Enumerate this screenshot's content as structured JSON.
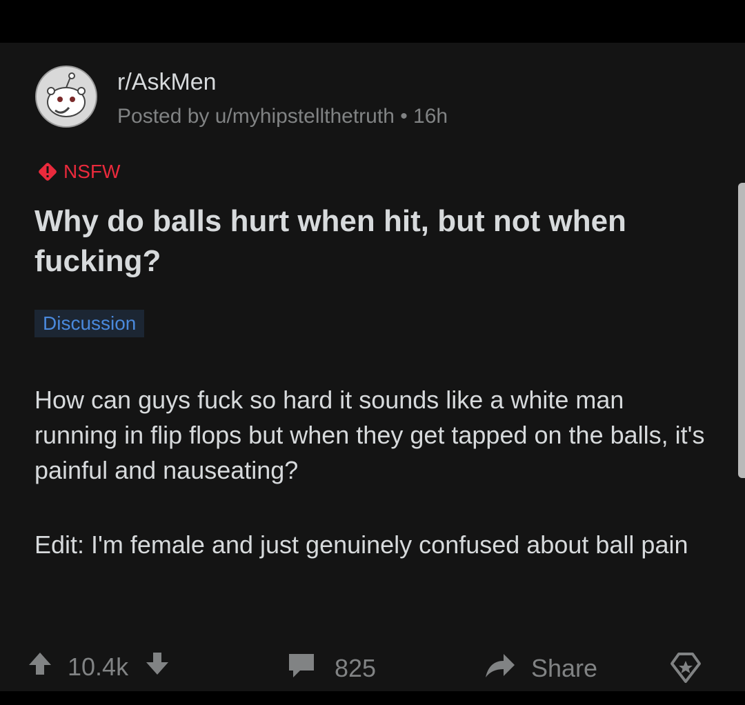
{
  "post": {
    "subreddit": "r/AskMen",
    "meta": "Posted by u/myhipstellthetruth • 16h",
    "nsfw_label": "NSFW",
    "title": "Why do balls hurt when hit, but not when fucking?",
    "flair": "Discussion",
    "body": [
      "How can guys fuck so hard it sounds like a white man running in flip flops but when they get tapped on the balls, it's painful and nauseating?",
      "Edit: I'm female and just genuinely confused about ball pain"
    ]
  },
  "actions": {
    "score": "10.4k",
    "comments": "825",
    "share_label": "Share"
  },
  "icons": {
    "avatar": "reddit-snoo-avatar-icon",
    "nsfw": "warning-diamond-icon",
    "upvote": "arrow-up-icon",
    "downvote": "arrow-down-icon",
    "comments": "comment-bubble-icon",
    "share": "share-arrow-icon",
    "award": "award-icon"
  },
  "colors": {
    "background": "#141414",
    "text": "#d7dadc",
    "muted": "#818384",
    "nsfw": "#ea2a3c",
    "flair_text": "#4a89dc",
    "flair_bg": "#1c2633"
  }
}
